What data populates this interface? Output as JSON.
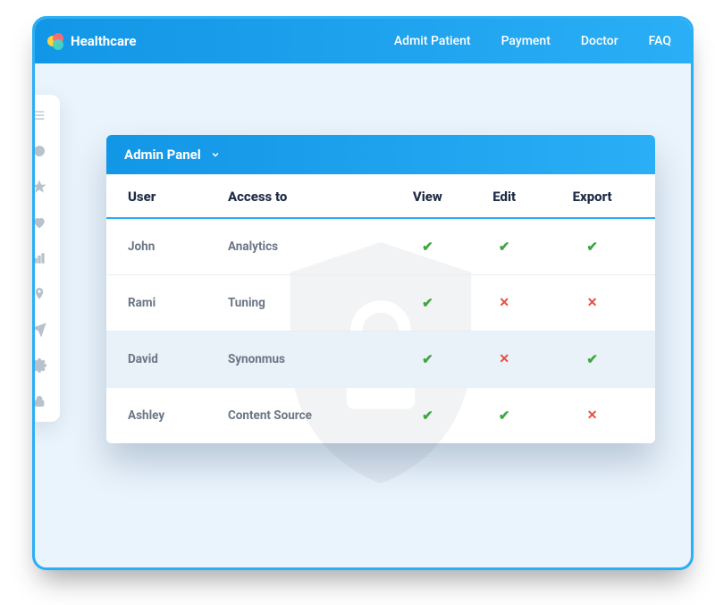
{
  "brand": {
    "name": "Healthcare"
  },
  "topnav": [
    "Admit Patient",
    "Payment",
    "Doctor",
    "FAQ"
  ],
  "sidebar_icons": [
    "menu",
    "target",
    "star",
    "heart",
    "bar",
    "pin",
    "send",
    "gear",
    "lock"
  ],
  "panel": {
    "title": "Admin Panel",
    "columns": [
      "User",
      "Access to",
      "View",
      "Edit",
      "Export"
    ],
    "rows": [
      {
        "user": "John",
        "access": "Analytics",
        "view": true,
        "edit": true,
        "export": true,
        "highlight": false
      },
      {
        "user": "Rami",
        "access": "Tuning",
        "view": true,
        "edit": false,
        "export": false,
        "highlight": false
      },
      {
        "user": "David",
        "access": "Synonmus",
        "view": true,
        "edit": false,
        "export": true,
        "highlight": true
      },
      {
        "user": "Ashley",
        "access": "Content Source",
        "view": true,
        "edit": true,
        "export": false,
        "highlight": false
      }
    ]
  },
  "glyphs": {
    "check": "✔",
    "cross": "✕"
  }
}
